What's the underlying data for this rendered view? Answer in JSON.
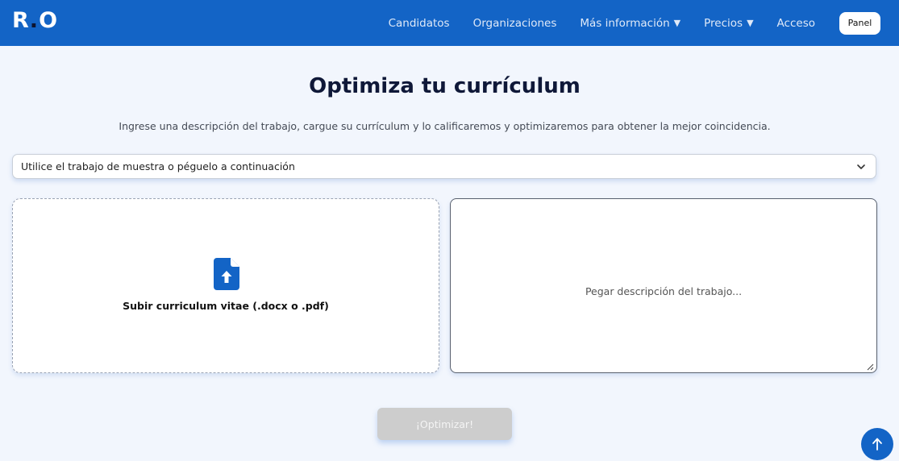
{
  "nav": {
    "logo_left": "R",
    "logo_dot": ".",
    "logo_right": "O",
    "items": [
      {
        "label": "Candidatos",
        "caret": false
      },
      {
        "label": "Organizaciones",
        "caret": false
      },
      {
        "label": "Más información",
        "caret": true
      },
      {
        "label": "Precios",
        "caret": true
      },
      {
        "label": "Acceso",
        "caret": false
      }
    ],
    "caret_glyph": "▼",
    "panel_label": "Panel"
  },
  "main": {
    "title": "Optimiza tu currículum",
    "subtitle": "Ingrese una descripción del trabajo, cargue su currículum y lo calificaremos y optimizaremos para obtener la mejor coincidencia.",
    "job_select": {
      "selected": "Utilice el trabajo de muestra o péguelo a continuación"
    },
    "upload": {
      "label": "Subir curriculum vitae (.docx o .pdf)",
      "icon": "file-upload-icon"
    },
    "job_description": {
      "value": "",
      "placeholder": "Pegar descripción del trabajo..."
    },
    "optimize_button": "¡Optimizar!"
  },
  "colors": {
    "nav_bg": "#1364c6",
    "page_bg": "#f2f6fd",
    "title": "#0f1838",
    "button_disabled": "#cdcdcd",
    "accent": "#1364c6"
  },
  "icons": {
    "select_chevron": "chevron-down-icon",
    "scroll_top": "arrow-up-icon"
  }
}
